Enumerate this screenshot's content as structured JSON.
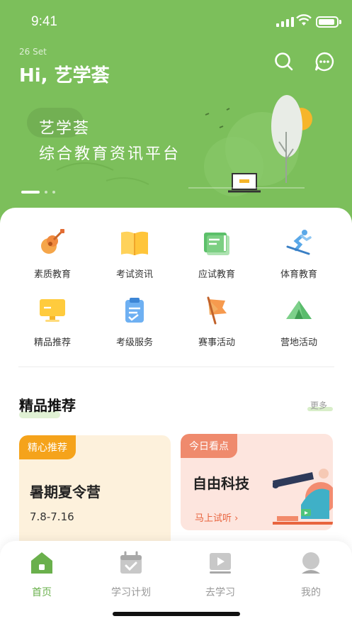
{
  "status_bar": {
    "time": "9:41"
  },
  "header": {
    "date": "26 Set",
    "greeting": "Hi, 艺学荟"
  },
  "banner": {
    "title": "艺学荟",
    "subtitle": "综合教育资讯平台",
    "page_dots": 3,
    "active_dot": 1
  },
  "categories": [
    {
      "label": "素质教育",
      "icon": "guitar-icon"
    },
    {
      "label": "考试资讯",
      "icon": "book-icon"
    },
    {
      "label": "应试教育",
      "icon": "notebook-icon"
    },
    {
      "label": "体育教育",
      "icon": "skier-icon"
    },
    {
      "label": "精品推荐",
      "icon": "monitor-icon"
    },
    {
      "label": "考级服务",
      "icon": "clipboard-icon"
    },
    {
      "label": "赛事活动",
      "icon": "flag-icon"
    },
    {
      "label": "营地活动",
      "icon": "tent-icon"
    }
  ],
  "featured": {
    "title": "精品推荐",
    "more": "更多",
    "cards": [
      {
        "tag": "精心推荐",
        "title": "暑期夏令营",
        "date": "7.8-7.16"
      },
      {
        "tag": "今日看点",
        "title": "自由科技",
        "link": "马上试听 ›"
      }
    ]
  },
  "tabbar": {
    "items": [
      {
        "label": "首页",
        "icon": "home-icon",
        "active": true
      },
      {
        "label": "学习计划",
        "icon": "calendar-icon",
        "active": false
      },
      {
        "label": "去学习",
        "icon": "video-icon",
        "active": false
      },
      {
        "label": "我的",
        "icon": "profile-icon",
        "active": false
      }
    ]
  },
  "colors": {
    "brand_green": "#7cbf5b",
    "active_tab": "#6ab04c",
    "tag_orange": "#f5a31b",
    "tag_coral": "#ef8a6d"
  }
}
